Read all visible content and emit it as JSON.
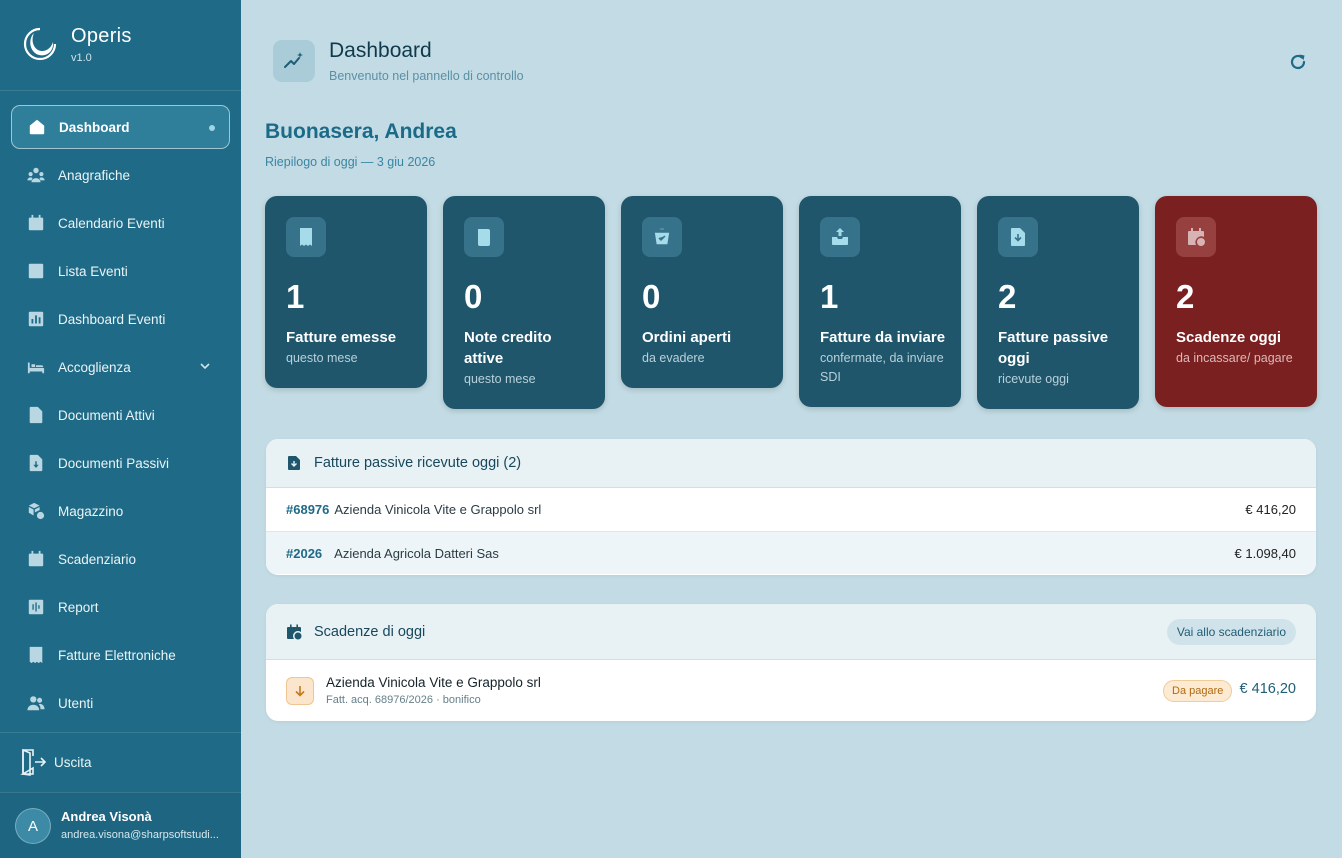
{
  "app": {
    "name": "Operis",
    "version": "v1.0"
  },
  "sidebar": {
    "items": [
      {
        "label": "Dashboard",
        "icon": "home-icon"
      },
      {
        "label": "Anagrafiche",
        "icon": "people-icon"
      },
      {
        "label": "Calendario Eventi",
        "icon": "calendar-icon"
      },
      {
        "label": "Lista Eventi",
        "icon": "checklist-icon"
      },
      {
        "label": "Dashboard Eventi",
        "icon": "bar-chart-icon"
      },
      {
        "label": "Accoglienza",
        "icon": "bed-icon"
      },
      {
        "label": "Documenti Attivi",
        "icon": "document-icon"
      },
      {
        "label": "Documenti Passivi",
        "icon": "document-download-icon"
      },
      {
        "label": "Magazzino",
        "icon": "boxes-icon"
      },
      {
        "label": "Scadenziario",
        "icon": "calendar-icon"
      },
      {
        "label": "Report",
        "icon": "report-icon"
      },
      {
        "label": "Fatture Elettroniche",
        "icon": "receipt-icon"
      },
      {
        "label": "Utenti",
        "icon": "users-icon"
      }
    ],
    "logout_label": "Uscita",
    "user": {
      "initial": "A",
      "name": "Andrea Visonà",
      "email": "andrea.visona@sharpsoftstudi..."
    }
  },
  "header": {
    "title": "Dashboard",
    "subtitle": "Benvenuto nel pannello di controllo"
  },
  "greeting": {
    "title": "Buonasera, Andrea",
    "subtitle": "Riepilogo di oggi — 3 giu 2026"
  },
  "cards": [
    {
      "value": "1",
      "label": "Fatture emesse",
      "sub": "questo mese",
      "icon": "receipt-icon"
    },
    {
      "value": "0",
      "label": "Note credito attive",
      "sub": "questo mese",
      "icon": "credit-note-icon"
    },
    {
      "value": "0",
      "label": "Ordini aperti",
      "sub": "da evadere",
      "icon": "shopping-basket-icon"
    },
    {
      "value": "1",
      "label": "Fatture da inviare",
      "sub": "confermate, da inviare SDI",
      "icon": "send-icon"
    },
    {
      "value": "2",
      "label": "Fatture passive oggi",
      "sub": "ricevute oggi",
      "icon": "document-download-icon"
    },
    {
      "value": "2",
      "label": "Scadenze oggi",
      "sub": "da incassare/ pagare",
      "icon": "calendar-clock-icon"
    }
  ],
  "passive_invoices": {
    "title": "Fatture passive ricevute oggi (2)",
    "rows": [
      {
        "number": "#68976",
        "supplier": "Azienda Vinicola Vite e Grappolo srl",
        "amount": "€ 416,20"
      },
      {
        "number": "#2026",
        "supplier": "Azienda Agricola Datteri Sas",
        "amount": "€ 1.098,40"
      }
    ]
  },
  "due_today": {
    "title": "Scadenze di oggi",
    "link_label": "Vai allo scadenziario",
    "rows": [
      {
        "name": "Azienda Vinicola Vite e Grappolo srl",
        "desc": "Fatt. acq. 68976/2026 · bonifico",
        "status": "Da pagare",
        "amount": "€ 416,20"
      }
    ]
  },
  "colors": {
    "sidebar": "#1f6a86",
    "background": "#c3dbe4",
    "card": "#1f566c",
    "card_alert": "#7a2020",
    "accent": "#1b6b88"
  }
}
